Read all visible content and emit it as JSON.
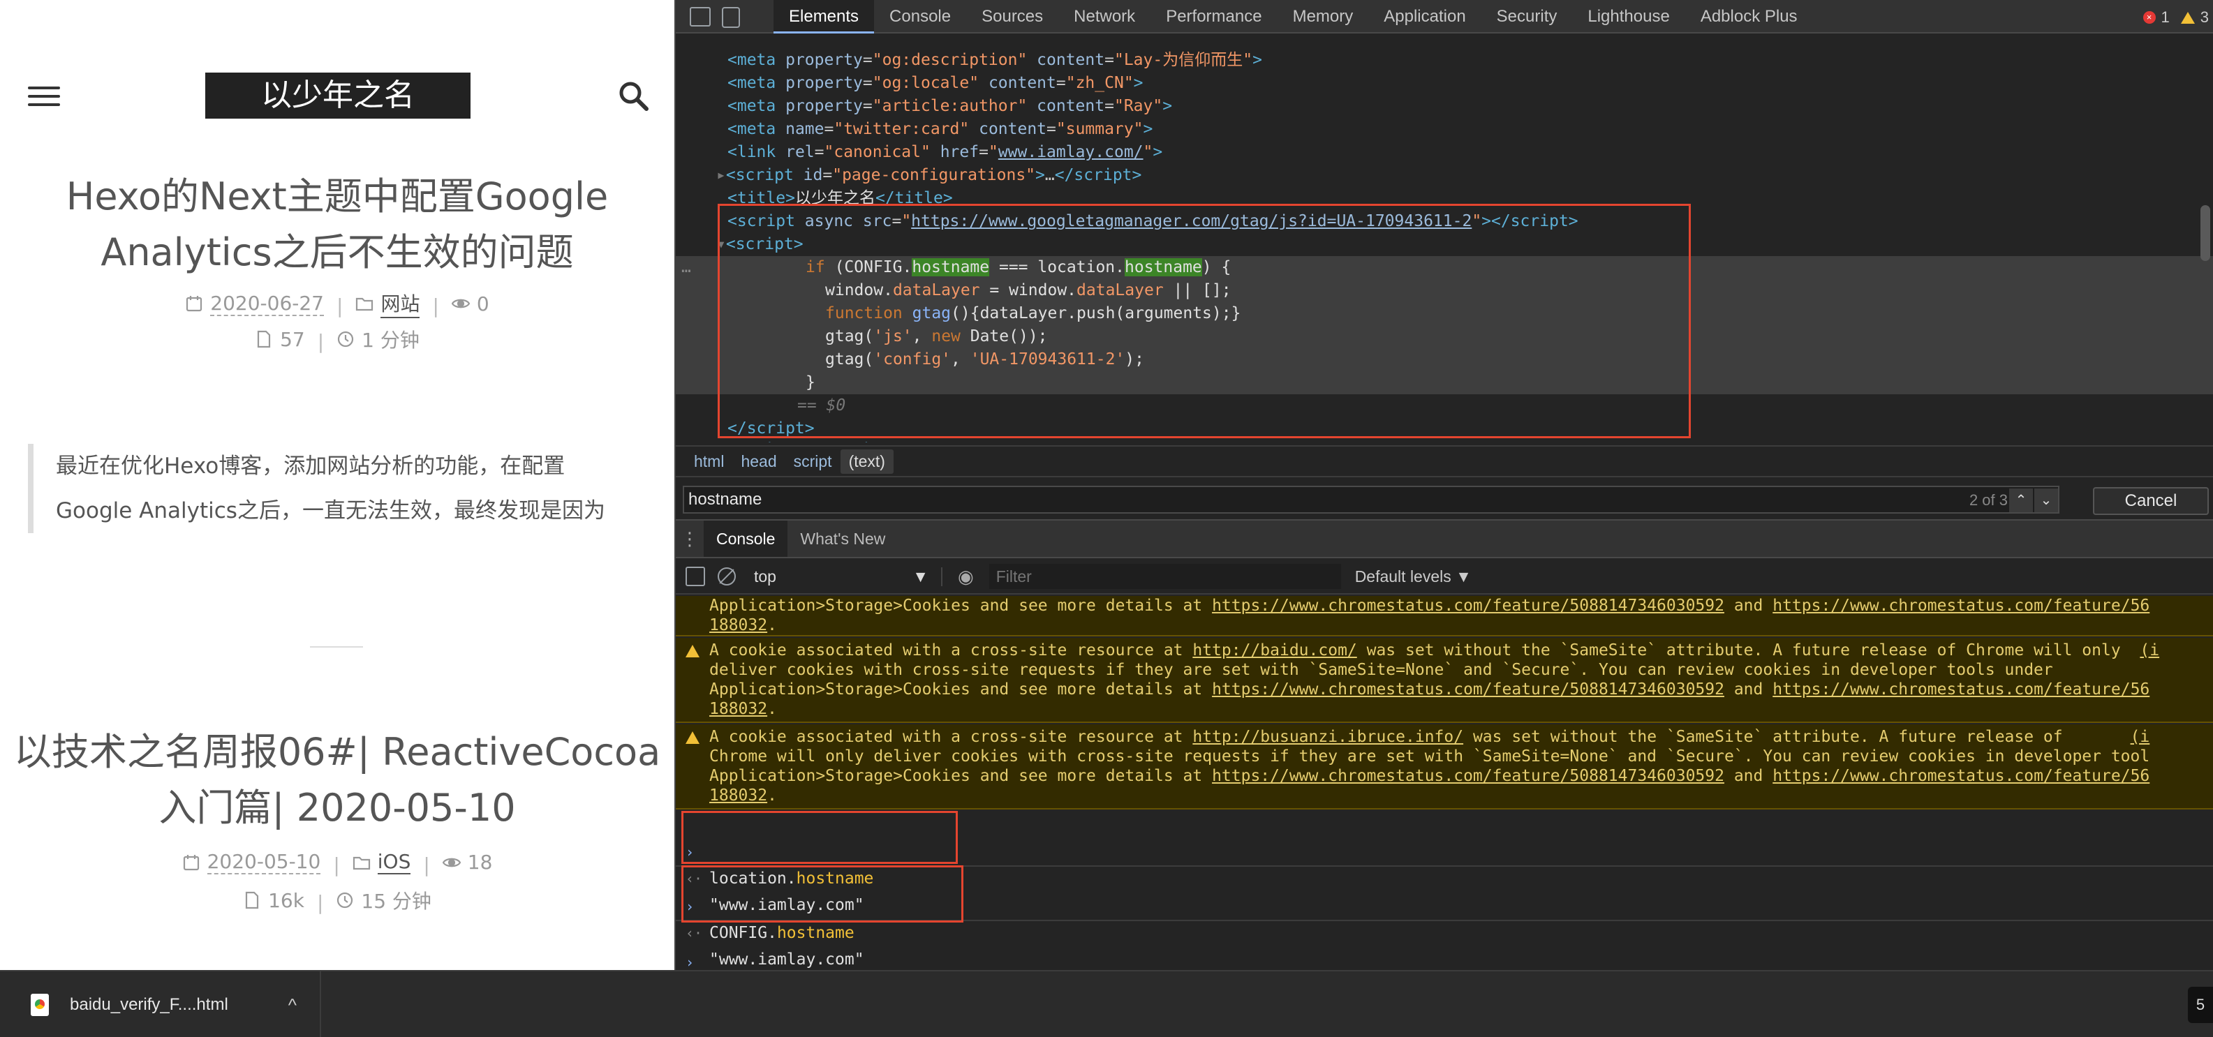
{
  "blog": {
    "brand": "以少年之名",
    "posts": [
      {
        "title_line1": "Hexo的Next主题中配置Google",
        "title_line2": "Analytics之后不生效的问题",
        "date": "2020-06-27",
        "category": "网站",
        "views": "0",
        "words": "57",
        "read_time": "1 分钟",
        "excerpt_line1": "最近在优化Hexo博客，添加网站分析的功能，在配置",
        "excerpt_line2": "Google Analytics之后，一直无法生效，最终发现是因为"
      },
      {
        "title_line1": "以技术之名周报06#| ReactiveCocoa",
        "title_line2": "入门篇| 2020-05-10",
        "date": "2020-05-10",
        "category": "iOS",
        "views": "18",
        "words": "16k",
        "read_time": "15 分钟"
      }
    ]
  },
  "downloads": {
    "file_name": "baidu_verify_F....html",
    "chevron": "^",
    "right_label": "5"
  },
  "devtools": {
    "tabs": [
      "Elements",
      "Console",
      "Sources",
      "Network",
      "Performance",
      "Memory",
      "Application",
      "Security",
      "Lighthouse",
      "Adblock Plus"
    ],
    "active_tab": "Elements",
    "error_count": "1",
    "warning_count": "3",
    "breadcrumbs": [
      "html",
      "head",
      "script",
      "(text)"
    ],
    "search": {
      "value": "hostname",
      "match": "2 of 3",
      "cancel": "Cancel"
    },
    "drawer_tabs": [
      "Console",
      "What's New"
    ],
    "console_toolbar": {
      "context": "top",
      "filter_placeholder": "Filter",
      "levels": "Default levels ▼"
    },
    "console_lines": {
      "cmd1": "location.hostname",
      "res1": "\"www.iamlay.com\"",
      "cmd2": "CONFIG.hostname",
      "res2": "\"www.iamlay.com\""
    }
  },
  "colors": {
    "accent_blue": "#8ab4f8",
    "highlight_box": "#e4452f",
    "warning_bg": "#332b00",
    "warning_text": "#e4cc6f",
    "search_match_bg": "#3c8527"
  }
}
